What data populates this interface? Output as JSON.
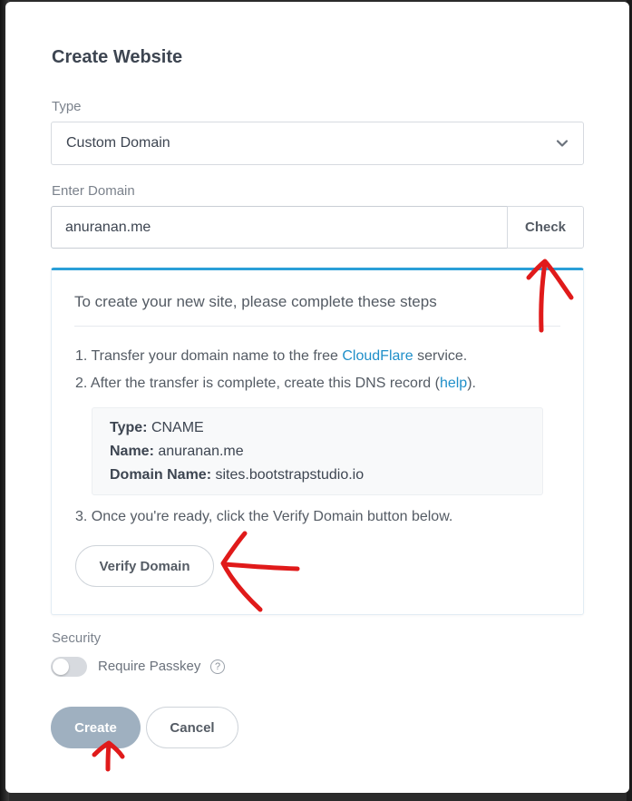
{
  "dialog": {
    "title": "Create Website",
    "type_label": "Type",
    "type_value": "Custom Domain",
    "domain_label": "Enter Domain",
    "domain_value": "anuranan.me",
    "check_label": "Check"
  },
  "steps": {
    "heading": "To create your new site, please complete these steps",
    "step1_prefix": "1. Transfer your domain name to the free ",
    "step1_link": "CloudFlare",
    "step1_suffix": " service.",
    "step2_prefix": "2. After the transfer is complete, create this DNS record (",
    "step2_link": "help",
    "step2_suffix": ").",
    "dns": {
      "type_key": "Type:",
      "type_value": "CNAME",
      "name_key": "Name:",
      "name_value": "anuranan.me",
      "domain_key": "Domain Name:",
      "domain_value": "sites.bootstrapstudio.io"
    },
    "step3": "3. Once you're ready, click the Verify Domain button below.",
    "verify_label": "Verify Domain"
  },
  "security": {
    "label": "Security",
    "toggle_label": "Require Passkey",
    "toggle_on": false,
    "help_glyph": "?"
  },
  "footer": {
    "create_label": "Create",
    "cancel_label": "Cancel"
  },
  "icons": {
    "select_chevron": "chevron-down-icon",
    "help": "question-circle-icon"
  },
  "colors": {
    "accent": "#2a9fd8",
    "link": "#1f8fc9",
    "create_disabled": "#9fb0c0",
    "annotation": "#e01a1a"
  }
}
